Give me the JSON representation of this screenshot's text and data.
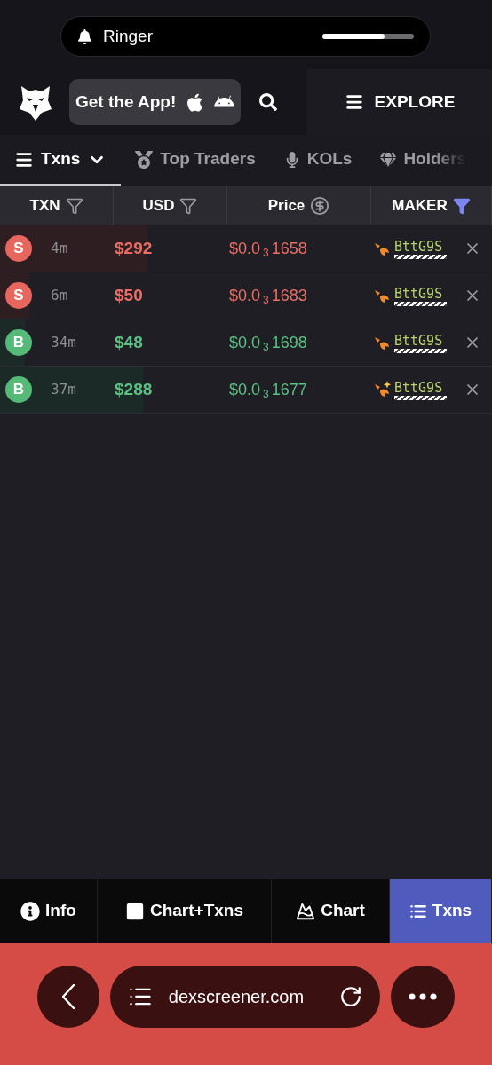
{
  "ringer": {
    "label": "Ringer",
    "level": 0.68
  },
  "header": {
    "app_button": "Get the App!",
    "explore": "EXPLORE"
  },
  "tabs": [
    {
      "label": "Txns",
      "selected": true,
      "kind": "menu"
    },
    {
      "label": "Top Traders",
      "selected": false,
      "kind": "medal"
    },
    {
      "label": "KOLs",
      "selected": false,
      "kind": "mic"
    },
    {
      "label": "Holders",
      "selected": false,
      "kind": "gem"
    }
  ],
  "columns": [
    {
      "label": "TXN",
      "kind": "filter",
      "active": false
    },
    {
      "label": "USD",
      "kind": "filter",
      "active": false
    },
    {
      "label": "Price",
      "kind": "currency",
      "active": false
    },
    {
      "label": "MAKER",
      "kind": "filter",
      "active": true
    }
  ],
  "rows": [
    {
      "kind": "sell",
      "side": "S",
      "time": "4m",
      "usd": "$292",
      "price": "$0.0",
      "zeros": "3",
      "price_rest": "1658",
      "maker": "BttG9S",
      "maker_new": false,
      "level": 0.3
    },
    {
      "kind": "sell",
      "side": "S",
      "time": "6m",
      "usd": "$50",
      "price": "$0.0",
      "zeros": "3",
      "price_rest": "1683",
      "maker": "BttG9S",
      "maker_new": false,
      "level": 0.06
    },
    {
      "kind": "buy",
      "side": "B",
      "time": "34m",
      "usd": "$48",
      "price": "$0.0",
      "zeros": "3",
      "price_rest": "1698",
      "maker": "BttG9S",
      "maker_new": false,
      "level": 0.05
    },
    {
      "kind": "buy",
      "side": "B",
      "time": "37m",
      "usd": "$288",
      "price": "$0.0",
      "zeros": "3",
      "price_rest": "1677",
      "maker": "BttG9S",
      "maker_new": true,
      "level": 0.29
    }
  ],
  "bottom_nav": [
    {
      "label": "Info",
      "kind": "info",
      "selected": false
    },
    {
      "label": "Chart+Txns",
      "kind": "split",
      "selected": false
    },
    {
      "label": "Chart",
      "kind": "chart",
      "selected": false
    },
    {
      "label": "Txns",
      "kind": "list",
      "selected": true
    }
  ],
  "browser": {
    "url": "dexscreener.com"
  }
}
